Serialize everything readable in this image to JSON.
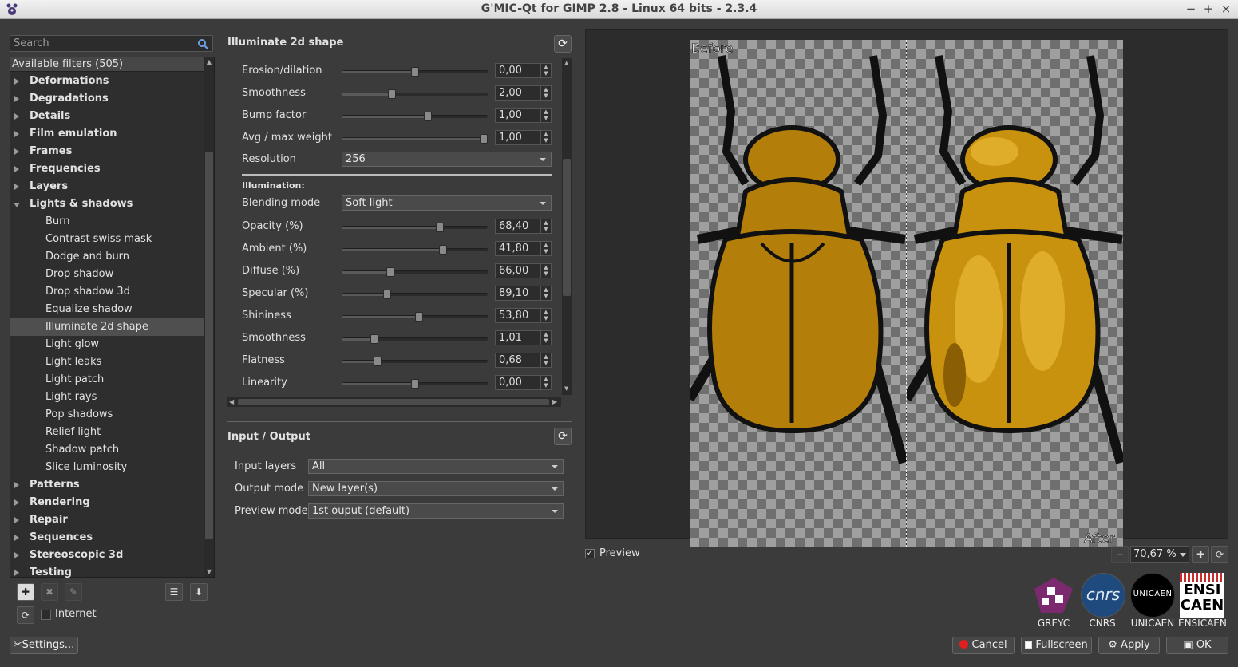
{
  "window": {
    "title": "G'MIC-Qt for GIMP 2.8 - Linux 64 bits - 2.3.4",
    "minimize": "−",
    "maximize": "+",
    "close": "×"
  },
  "search": {
    "placeholder": "Search"
  },
  "tree": {
    "header": "Available filters (505)",
    "items": [
      {
        "label": "Deformations",
        "kind": "cat"
      },
      {
        "label": "Degradations",
        "kind": "cat"
      },
      {
        "label": "Details",
        "kind": "cat"
      },
      {
        "label": "Film emulation",
        "kind": "cat"
      },
      {
        "label": "Frames",
        "kind": "cat"
      },
      {
        "label": "Frequencies",
        "kind": "cat"
      },
      {
        "label": "Layers",
        "kind": "cat"
      },
      {
        "label": "Lights & shadows",
        "kind": "open"
      },
      {
        "label": "Burn",
        "kind": "leaf"
      },
      {
        "label": "Contrast swiss mask",
        "kind": "leaf"
      },
      {
        "label": "Dodge and burn",
        "kind": "leaf"
      },
      {
        "label": "Drop shadow",
        "kind": "leaf"
      },
      {
        "label": "Drop shadow 3d",
        "kind": "leaf"
      },
      {
        "label": "Equalize shadow",
        "kind": "leaf"
      },
      {
        "label": "Illuminate 2d shape",
        "kind": "leaf",
        "selected": true
      },
      {
        "label": "Light glow",
        "kind": "leaf"
      },
      {
        "label": "Light leaks",
        "kind": "leaf"
      },
      {
        "label": "Light patch",
        "kind": "leaf"
      },
      {
        "label": "Light rays",
        "kind": "leaf"
      },
      {
        "label": "Pop shadows",
        "kind": "leaf"
      },
      {
        "label": "Relief light",
        "kind": "leaf"
      },
      {
        "label": "Shadow patch",
        "kind": "leaf"
      },
      {
        "label": "Slice luminosity",
        "kind": "leaf"
      },
      {
        "label": "Patterns",
        "kind": "cat"
      },
      {
        "label": "Rendering",
        "kind": "cat"
      },
      {
        "label": "Repair",
        "kind": "cat"
      },
      {
        "label": "Sequences",
        "kind": "cat"
      },
      {
        "label": "Stereoscopic 3d",
        "kind": "cat"
      },
      {
        "label": "Testing",
        "kind": "cat"
      }
    ]
  },
  "internet": {
    "label": "Internet",
    "checked": false
  },
  "settings_button": "Settings...",
  "filter": {
    "title": "Illuminate 2d shape",
    "params": [
      {
        "label": "Erosion/dilation",
        "value": "0,00",
        "pos": 0.5
      },
      {
        "label": "Smoothness",
        "value": "2,00",
        "pos": 0.34
      },
      {
        "label": "Bump factor",
        "value": "1,00",
        "pos": 0.59
      },
      {
        "label": "Avg / max weight",
        "value": "1,00",
        "pos": 0.97
      }
    ],
    "resolution": {
      "label": "Resolution",
      "value": "256"
    },
    "illumination_heading": "Illumination:",
    "blending": {
      "label": "Blending mode",
      "value": "Soft light"
    },
    "params2": [
      {
        "label": "Opacity (%)",
        "value": "68,40",
        "pos": 0.67
      },
      {
        "label": "Ambient (%)",
        "value": "41,80",
        "pos": 0.69
      },
      {
        "label": "Diffuse (%)",
        "value": "66,00",
        "pos": 0.33
      },
      {
        "label": "Specular (%)",
        "value": "89,10",
        "pos": 0.31
      },
      {
        "label": "Shininess",
        "value": "53,80",
        "pos": 0.53
      },
      {
        "label": "Smoothness",
        "value": "1,01",
        "pos": 0.22
      },
      {
        "label": "Flatness",
        "value": "0,68",
        "pos": 0.24
      },
      {
        "label": "Linearity",
        "value": "0,00",
        "pos": 0.5
      }
    ]
  },
  "io": {
    "title": "Input / Output",
    "input_layers": {
      "label": "Input layers",
      "value": "All"
    },
    "output_mode": {
      "label": "Output mode",
      "value": "New layer(s)"
    },
    "preview_mode": {
      "label": "Preview mode",
      "value": "1st ouput (default)"
    }
  },
  "preview": {
    "before_label": "Before",
    "after_label": "After",
    "checkbox_label": "Preview",
    "checked": true,
    "zoom": "70,67 %"
  },
  "logos": [
    {
      "label": "GREYC",
      "color": "#7b2a6f"
    },
    {
      "label": "CNRS",
      "color": "#1e4a7e"
    },
    {
      "label": "UNICAEN",
      "color": "#000000"
    },
    {
      "label": "ENSICAEN",
      "color": "#ffffff"
    }
  ],
  "logo_text": {
    "cnrs": "cnrs",
    "unicaen": "UNICAEN",
    "ensicaen_top": "ENSI",
    "ensicaen_bottom": "CAEN"
  },
  "buttons": {
    "cancel": "Cancel",
    "fullscreen": "Fullscreen",
    "apply": "Apply",
    "ok": "OK"
  },
  "colors": {
    "beetle_fill": "#b47e0a",
    "beetle_light": "#d9a51f",
    "beetle_dark": "#8a5e05",
    "cancel_dot": "#e02020"
  }
}
